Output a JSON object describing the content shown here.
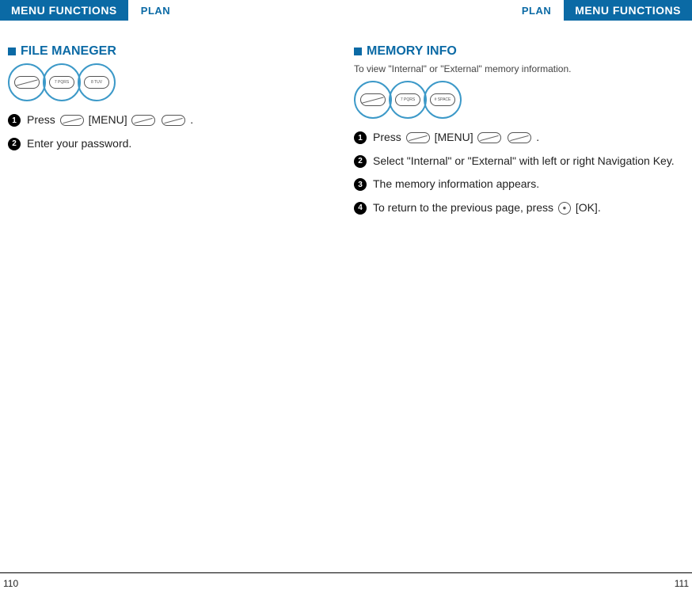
{
  "header": {
    "menuFunctions": "MENU FUNCTIONS",
    "plan": "PLAN"
  },
  "left": {
    "sectionTitle": "FILE MANEGER",
    "circles": {
      "c1": "",
      "c2": "7 PQRS",
      "c3": "8 TUV"
    },
    "steps": [
      {
        "num": "1",
        "textPre": "Press",
        "textMid": "[MENU]",
        "textPost": "."
      },
      {
        "num": "2",
        "text": "Enter your password."
      }
    ]
  },
  "right": {
    "sectionTitle": "MEMORY INFO",
    "subtitle": "To view \"Internal\" or \"External\" memory information.",
    "circles": {
      "c1": "",
      "c2": "7 PQRS",
      "c3": "# SPACE"
    },
    "steps": [
      {
        "num": "1",
        "textPre": "Press",
        "textMid": "[MENU]",
        "textPost": "."
      },
      {
        "num": "2",
        "text": "Select \"Internal\" or \"External\" with left or right Navigation Key."
      },
      {
        "num": "3",
        "text": "The memory information appears."
      },
      {
        "num": "4",
        "textPre": "To return to the previous page, press",
        "textPost": "[OK]."
      }
    ]
  },
  "footer": {
    "leftPageNum": "110",
    "rightPageNum": "111"
  }
}
